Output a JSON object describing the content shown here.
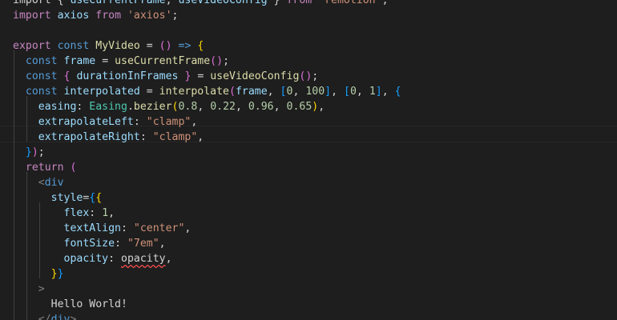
{
  "editor": {
    "theme_colors": {
      "background": "#1e1e1e",
      "keyword": "#569cd6",
      "control": "#c586c0",
      "function": "#dcdcaa",
      "variable": "#9cdcfe",
      "class": "#4ec9b0",
      "string": "#ce9178",
      "number": "#b5cea8",
      "text": "#d4d4d4",
      "bracket_1": "#ffd700",
      "bracket_2": "#da70d6",
      "bracket_3": "#179fff",
      "error_squiggle": "#f14c4c"
    },
    "lines": [
      {
        "tokens": [
          [
            "pun",
            "import { "
          ],
          [
            "var",
            "useCurrentFrame"
          ],
          [
            "pun",
            ", "
          ],
          [
            "var",
            "useVideoConfig"
          ],
          [
            "pun",
            " } "
          ],
          [
            "ctl",
            "from"
          ],
          [
            "pun",
            " "
          ],
          [
            "str",
            "'remotion'"
          ],
          [
            "pun",
            ";"
          ]
        ]
      },
      {
        "tokens": [
          [
            "ctl",
            "import"
          ],
          [
            "pun",
            " "
          ],
          [
            "var",
            "axios"
          ],
          [
            "pun",
            " "
          ],
          [
            "ctl",
            "from"
          ],
          [
            "pun",
            " "
          ],
          [
            "str",
            "'axios'"
          ],
          [
            "pun",
            ";"
          ]
        ]
      },
      {
        "tokens": []
      },
      {
        "tokens": [
          [
            "ctl",
            "export"
          ],
          [
            "pun",
            " "
          ],
          [
            "kw",
            "const"
          ],
          [
            "pun",
            " "
          ],
          [
            "fn",
            "MyVideo"
          ],
          [
            "pun",
            " = "
          ],
          [
            "b2",
            "()"
          ],
          [
            "pun",
            " "
          ],
          [
            "kw",
            "=>"
          ],
          [
            "pun",
            " "
          ],
          [
            "b1",
            "{"
          ]
        ]
      },
      {
        "tokens": [
          [
            "pun",
            "  "
          ],
          [
            "kw",
            "const"
          ],
          [
            "pun",
            " "
          ],
          [
            "var",
            "frame"
          ],
          [
            "pun",
            " = "
          ],
          [
            "fn",
            "useCurrentFrame"
          ],
          [
            "b2",
            "()"
          ],
          [
            "pun",
            ";"
          ]
        ]
      },
      {
        "tokens": [
          [
            "pun",
            "  "
          ],
          [
            "kw",
            "const"
          ],
          [
            "pun",
            " "
          ],
          [
            "b2",
            "{"
          ],
          [
            "pun",
            " "
          ],
          [
            "var",
            "durationInFrames"
          ],
          [
            "pun",
            " "
          ],
          [
            "b2",
            "}"
          ],
          [
            "pun",
            " = "
          ],
          [
            "fn",
            "useVideoConfig"
          ],
          [
            "b2",
            "()"
          ],
          [
            "pun",
            ";"
          ]
        ]
      },
      {
        "tokens": [
          [
            "pun",
            "  "
          ],
          [
            "kw",
            "const"
          ],
          [
            "pun",
            " "
          ],
          [
            "var",
            "interpolated"
          ],
          [
            "pun",
            " = "
          ],
          [
            "fn",
            "interpolate"
          ],
          [
            "b2",
            "("
          ],
          [
            "var",
            "frame"
          ],
          [
            "pun",
            ", "
          ],
          [
            "b3",
            "["
          ],
          [
            "num",
            "0"
          ],
          [
            "pun",
            ", "
          ],
          [
            "num",
            "100"
          ],
          [
            "b3",
            "]"
          ],
          [
            "pun",
            ", "
          ],
          [
            "b3",
            "["
          ],
          [
            "num",
            "0"
          ],
          [
            "pun",
            ", "
          ],
          [
            "num",
            "1"
          ],
          [
            "b3",
            "]"
          ],
          [
            "pun",
            ", "
          ],
          [
            "b3",
            "{"
          ]
        ]
      },
      {
        "tokens": [
          [
            "pun",
            "    "
          ],
          [
            "var",
            "easing"
          ],
          [
            "pun",
            ": "
          ],
          [
            "cls",
            "Easing"
          ],
          [
            "pun",
            "."
          ],
          [
            "fn",
            "bezier"
          ],
          [
            "b1",
            "("
          ],
          [
            "num",
            "0.8"
          ],
          [
            "pun",
            ", "
          ],
          [
            "num",
            "0.22"
          ],
          [
            "pun",
            ", "
          ],
          [
            "num",
            "0.96"
          ],
          [
            "pun",
            ", "
          ],
          [
            "num",
            "0.65"
          ],
          [
            "b1",
            ")"
          ],
          [
            "pun",
            ","
          ]
        ]
      },
      {
        "tokens": [
          [
            "pun",
            "    "
          ],
          [
            "var",
            "extrapolateLeft"
          ],
          [
            "pun",
            ": "
          ],
          [
            "str",
            "\"clamp\""
          ],
          [
            "pun",
            ","
          ]
        ]
      },
      {
        "tokens": [
          [
            "pun",
            "    "
          ],
          [
            "var",
            "extrapolateRight"
          ],
          [
            "pun",
            ": "
          ],
          [
            "str",
            "\"clamp\""
          ],
          [
            "pun",
            ","
          ]
        ]
      },
      {
        "tokens": [
          [
            "pun",
            "  "
          ],
          [
            "b3",
            "}"
          ],
          [
            "b2",
            ")"
          ],
          [
            "pun",
            ";"
          ]
        ]
      },
      {
        "tokens": [
          [
            "pun",
            "  "
          ],
          [
            "ctl",
            "return"
          ],
          [
            "pun",
            " "
          ],
          [
            "b2",
            "("
          ]
        ]
      },
      {
        "tokens": [
          [
            "pun",
            "    "
          ],
          [
            "tag",
            "<"
          ],
          [
            "kw",
            "div"
          ]
        ]
      },
      {
        "tokens": [
          [
            "pun",
            "      "
          ],
          [
            "var",
            "style"
          ],
          [
            "pun",
            "="
          ],
          [
            "b3",
            "{"
          ],
          [
            "b1",
            "{"
          ]
        ]
      },
      {
        "tokens": [
          [
            "pun",
            "        "
          ],
          [
            "var",
            "flex"
          ],
          [
            "pun",
            ": "
          ],
          [
            "num",
            "1"
          ],
          [
            "pun",
            ","
          ]
        ]
      },
      {
        "tokens": [
          [
            "pun",
            "        "
          ],
          [
            "var",
            "textAlign"
          ],
          [
            "pun",
            ": "
          ],
          [
            "str",
            "\"center\""
          ],
          [
            "pun",
            ","
          ]
        ]
      },
      {
        "tokens": [
          [
            "pun",
            "        "
          ],
          [
            "var",
            "fontSize"
          ],
          [
            "pun",
            ": "
          ],
          [
            "str",
            "\"7em\""
          ],
          [
            "pun",
            ","
          ]
        ]
      },
      {
        "tokens": [
          [
            "pun",
            "        "
          ],
          [
            "var",
            "opacity"
          ],
          [
            "pun",
            ": "
          ],
          [
            "err",
            "opacity"
          ],
          [
            "pun",
            ","
          ]
        ]
      },
      {
        "tokens": [
          [
            "pun",
            "      "
          ],
          [
            "b1",
            "}"
          ],
          [
            "b3",
            "}"
          ]
        ]
      },
      {
        "tokens": [
          [
            "pun",
            "    "
          ],
          [
            "tag",
            ">"
          ]
        ]
      },
      {
        "tokens": [
          [
            "pun",
            "      "
          ],
          [
            "txt",
            "Hello World!"
          ]
        ]
      },
      {
        "tokens": [
          [
            "pun",
            "    "
          ],
          [
            "tag",
            "</"
          ],
          [
            "kw",
            "div"
          ],
          [
            "tag",
            ">"
          ]
        ]
      }
    ]
  }
}
